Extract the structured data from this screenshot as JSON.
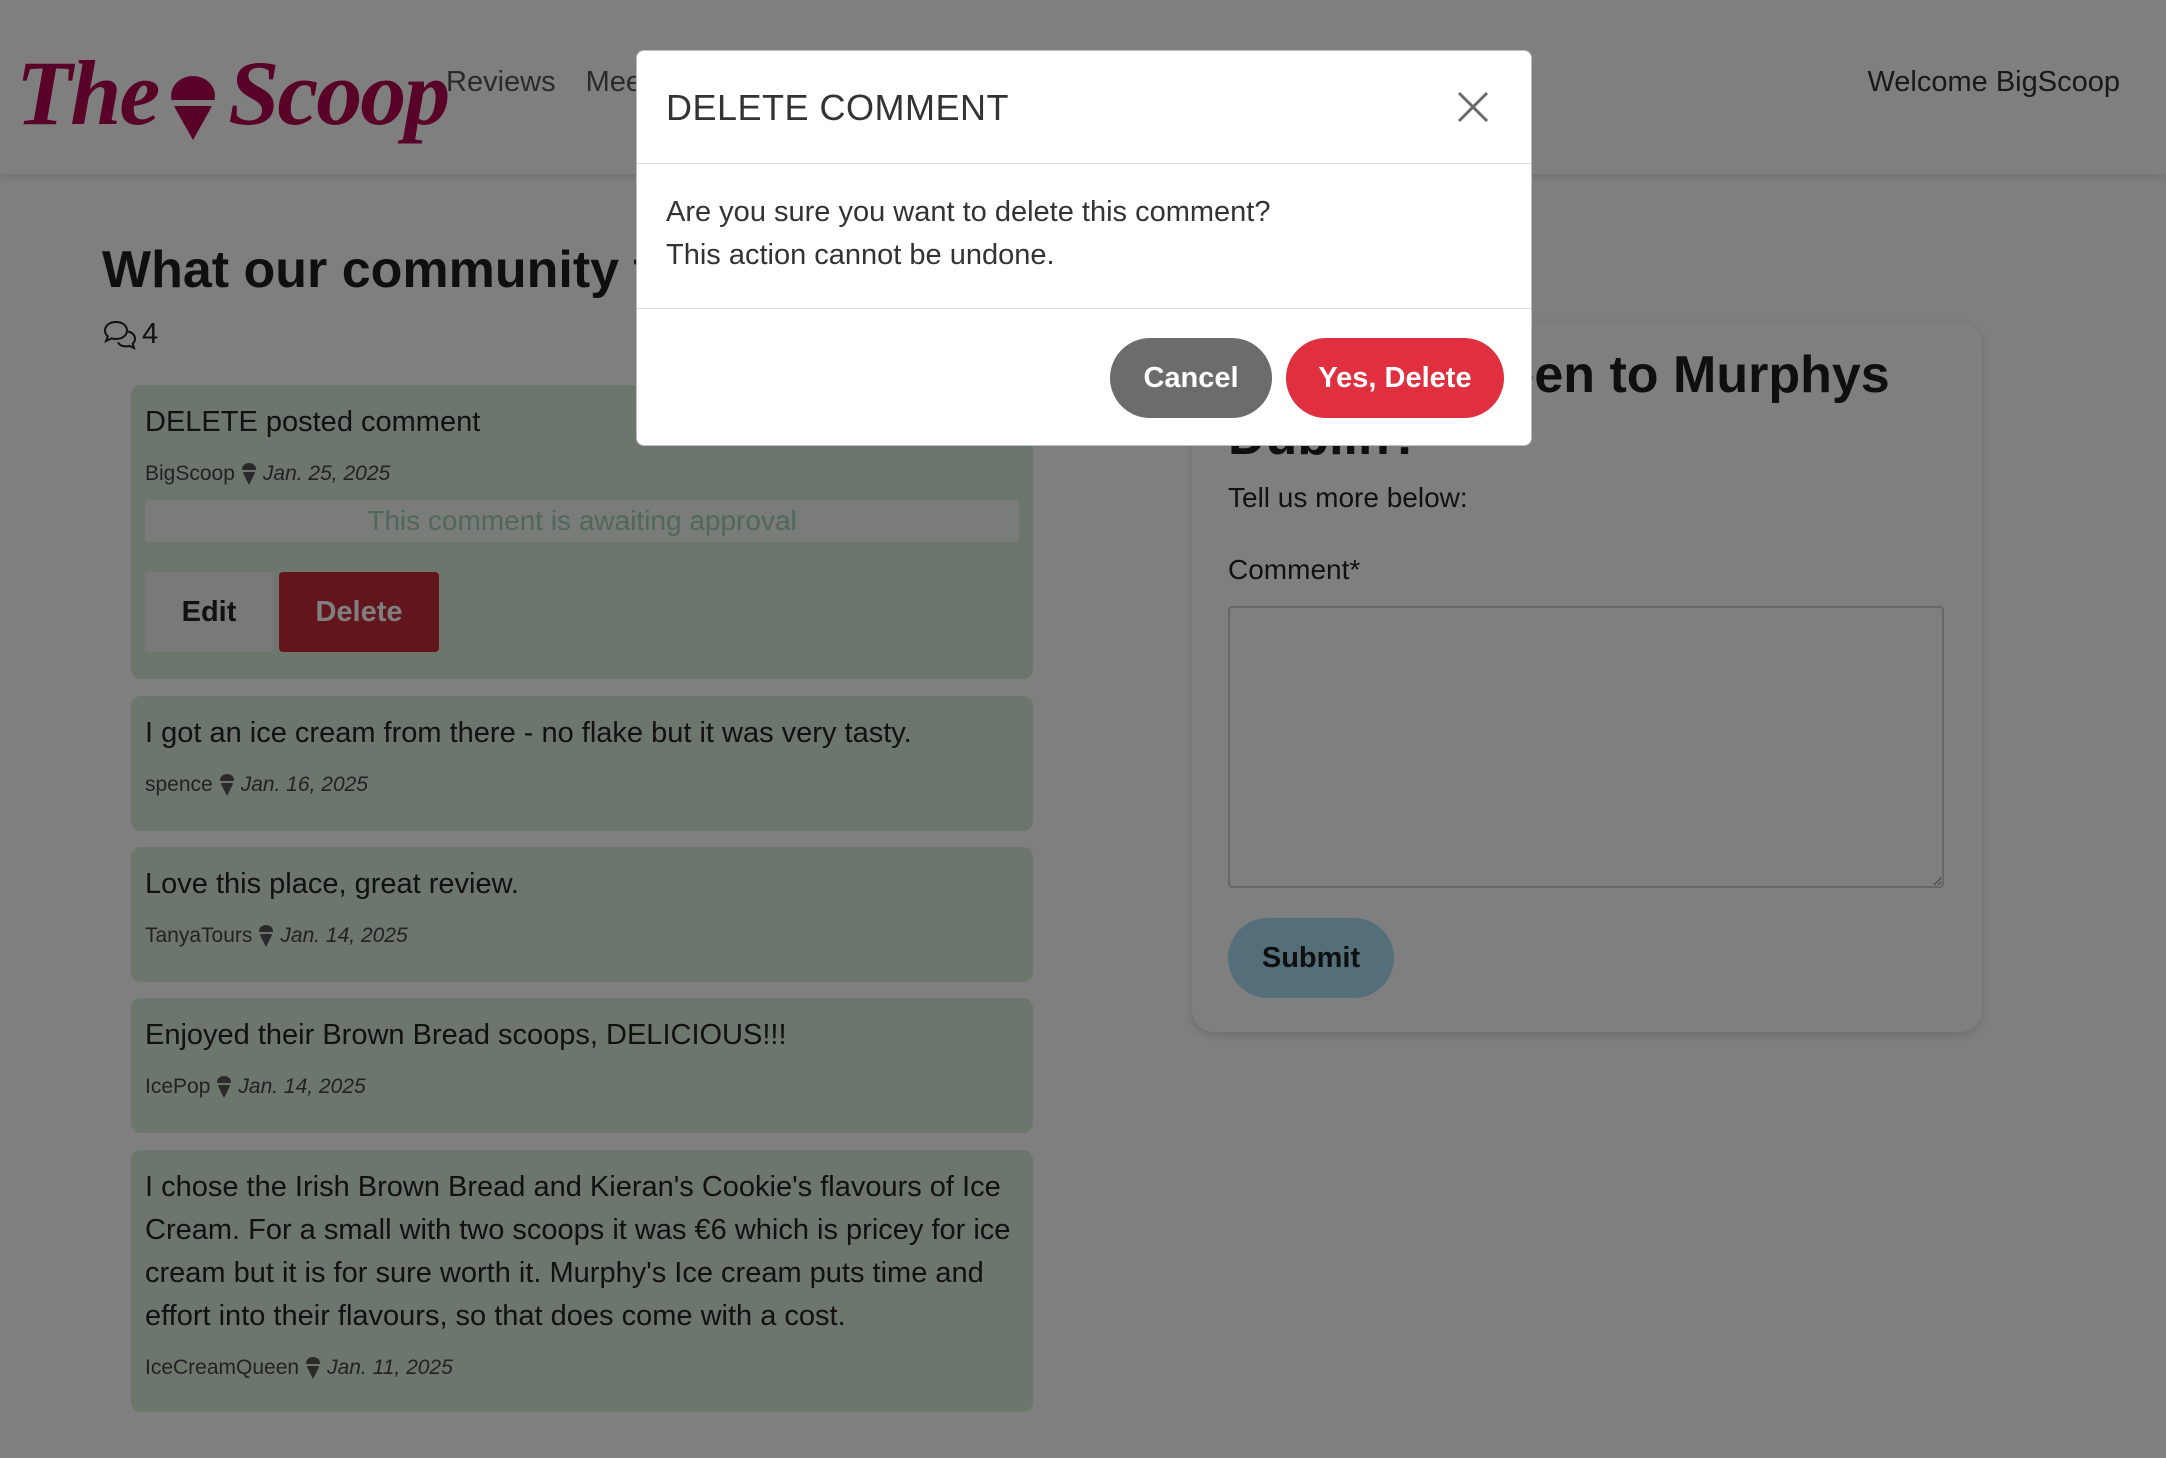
{
  "brand": {
    "word1": "The",
    "word2": "Scoop",
    "color": "#b0064f",
    "logo_icon": "ice-cream-cone-icon"
  },
  "nav": {
    "links": [
      "Reviews",
      "Meet"
    ],
    "welcome": "Welcome BigScoop"
  },
  "comments_section": {
    "title": "What our community thi",
    "count": "4",
    "count_icon": "chat-bubbles-icon"
  },
  "comments": [
    {
      "body": "DELETE posted comment",
      "author": "BigScoop",
      "date": "Jan. 25, 2025",
      "status": "This comment is awaiting approval",
      "edit_label": "Edit",
      "delete_label": "Delete"
    },
    {
      "body": "I got an ice cream from there - no flake but it was very tasty.",
      "author": "spence",
      "date": "Jan. 16, 2025"
    },
    {
      "body": "Love this place, great review.",
      "author": "TanyaTours",
      "date": "Jan. 14, 2025"
    },
    {
      "body": "Enjoyed their Brown Bread scoops, DELICIOUS!!!",
      "author": "IcePop",
      "date": "Jan. 14, 2025"
    },
    {
      "body": "I chose the Irish Brown Bread and Kieran's Cookie's flavours of Ice Cream. For a small with two scoops it was €6 which is pricey for ice cream but it is for sure worth it. Murphy's Ice cream puts time and effort into their flavours, so that does come with a cost.",
      "author": "IceCreamQueen",
      "date": "Jan. 11, 2025"
    }
  ],
  "form": {
    "title": "Have you been to Murphys Dublin?",
    "subtitle": "Tell us more below:",
    "comment_label": "Comment*",
    "submit_label": "Submit"
  },
  "modal": {
    "title": "DELETE COMMENT",
    "line1": "Are you sure you want to delete this comment?",
    "line2": "This action cannot be undone.",
    "cancel_label": "Cancel",
    "confirm_label": "Yes, Delete"
  },
  "colors": {
    "comment_bg": "#d8ecda",
    "delete_red": "#c72a3a",
    "confirm_red": "#e0303f",
    "cancel_gray": "#6c6c6c",
    "submit_blue": "#a9dcf5"
  }
}
